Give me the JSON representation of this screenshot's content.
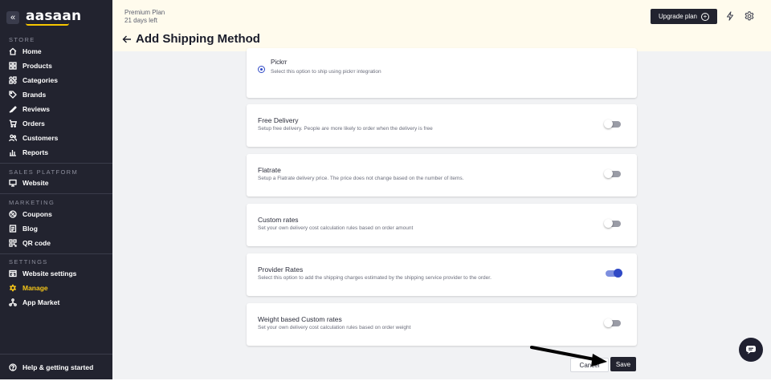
{
  "brand": {
    "name": "aasaan",
    "accent": "#f5c518",
    "sidebar_bg": "#22232f"
  },
  "sidebar": {
    "collapse_glyph": "«",
    "sections": {
      "store": "STORE",
      "sales_platform": "SALES PLATFORM",
      "marketing": "MARKETING",
      "settings": "SETTINGS"
    },
    "items": {
      "home": "Home",
      "products": "Products",
      "categories": "Categories",
      "brands": "Brands",
      "reviews": "Reviews",
      "orders": "Orders",
      "customers": "Customers",
      "reports": "Reports",
      "website": "Website",
      "coupons": "Coupons",
      "blog": "Blog",
      "qr_code": "QR code",
      "website_settings": "Website settings",
      "manage": "Manage",
      "app_market": "App Market",
      "help": "Help & getting started"
    },
    "active_item": "Manage"
  },
  "topbar": {
    "plan_name": "Premium Plan",
    "plan_days": "21 days left",
    "upgrade_label": "Upgrade plan",
    "icons": [
      "bolt-icon",
      "gear-icon"
    ]
  },
  "page": {
    "title": "Add Shipping Method"
  },
  "methods": [
    {
      "title": "Pickrr",
      "description": "Select this option to ship using pickrr integration",
      "control": "radio",
      "selected": true
    },
    {
      "title": "Free Delivery",
      "description": "Setup free delivery. People are more likely to order when the delivery is free",
      "control": "toggle",
      "enabled": false
    },
    {
      "title": "Flatrate",
      "description": "Setup a Flatrate delivery price. The price does not change based on the number of items.",
      "control": "toggle",
      "enabled": false
    },
    {
      "title": "Custom rates",
      "description": "Set your own delivery cost calculation rules based on order amount",
      "control": "toggle",
      "enabled": false
    },
    {
      "title": "Provider Rates",
      "description": "Select this option to add the shipping charges estimated by the shipping service provider to the order.",
      "control": "toggle",
      "enabled": true
    },
    {
      "title": "Weight based Custom rates",
      "description": "Set your own delivery cost calculation rules based on order weight",
      "control": "toggle",
      "enabled": false
    }
  ],
  "actions": {
    "cancel_label": "Cancel",
    "save_label": "Save"
  },
  "colors": {
    "toggle_on": "#2f49c6",
    "topbar_bg": "#fffbed",
    "content_bg": "#f1f2f4"
  }
}
